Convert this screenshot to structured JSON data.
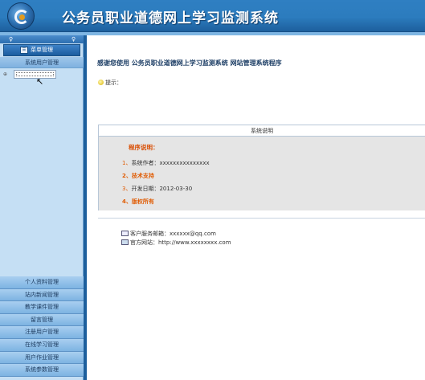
{
  "header": {
    "title": "公务员职业道德网上学习监测系统"
  },
  "sidebar": {
    "menu_title": "菜单管理",
    "section_label": "系统用户管理",
    "bottom_items": [
      "个人资料管理",
      "站内新闻管理",
      "教学课件管理",
      "留言管理",
      "注册用户管理",
      "在线学习管理",
      "用户作业管理",
      "系统参数管理"
    ]
  },
  "main": {
    "welcome": "感谢您使用  公务员职业道德网上学习监测系统  网站管理系统程序",
    "tip": "提示：",
    "panel": {
      "header": "系统说明",
      "section_title": "程序说明：",
      "items": [
        {
          "num": "1、",
          "text": "系统作者：xxxxxxxxxxxxxxx"
        },
        {
          "num": "2、",
          "text": "技术支持"
        },
        {
          "num": "3、",
          "text": "开发日期：2012-03-30"
        },
        {
          "num": "4、",
          "text": "版权所有"
        }
      ]
    },
    "contact": {
      "email": "客户服务邮箱：xxxxxx@qq.com",
      "website": "官方网站：http://www.xxxxxxxx.com"
    }
  },
  "colors": {
    "header_blue": "#2c7cbe",
    "sidebar_bg": "#c5dff4",
    "accent_orange": "#e05a00"
  }
}
